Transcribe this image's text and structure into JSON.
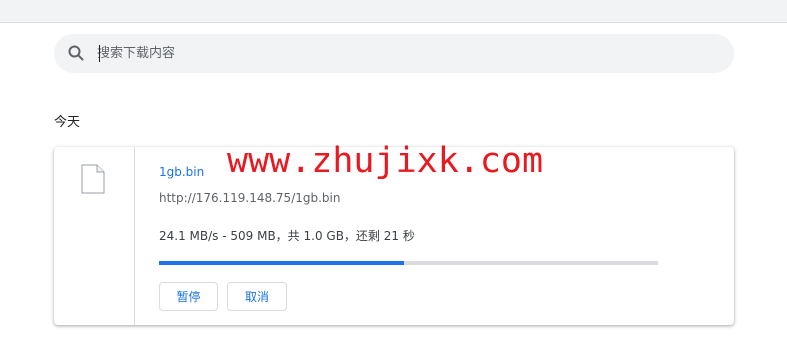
{
  "search": {
    "placeholder": "搜索下载内容",
    "value": ""
  },
  "section": {
    "date_label": "今天"
  },
  "download": {
    "file_name": "1gb.bin",
    "url": "http://176.119.148.75/1gb.bin",
    "status": "24.1 MB/s - 509 MB，共 1.0 GB，还剩 21 秒",
    "progress": 0.49,
    "pause_label": "暂停",
    "cancel_label": "取消"
  },
  "watermark": "www.zhujixk.com",
  "colors": {
    "accent": "#1a73e8",
    "watermark": "#e8191f"
  }
}
